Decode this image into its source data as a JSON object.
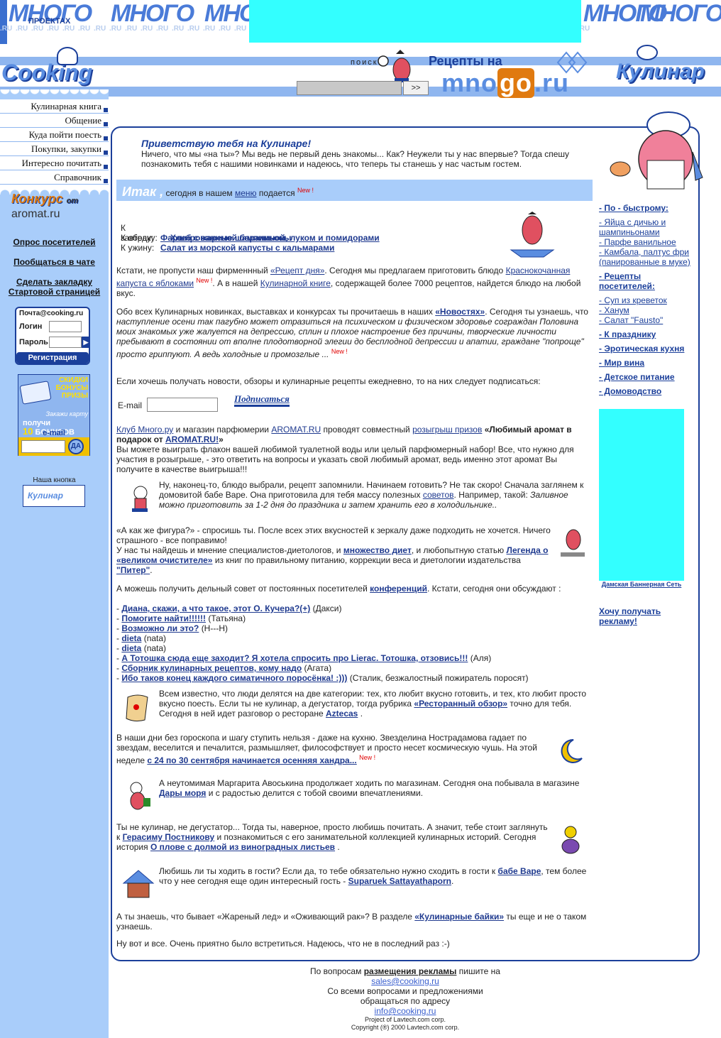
{
  "top_banner": {
    "word": "МНОГО",
    "proektah": "ПРОЕКТАХ",
    "ru_text": ".RU .RU .RU .RU .RU .RU .RU .RU .RU .RU .RU .RU .RU .RU .RU .RU .RU .RU .RU .RU .RU .RU .RU .RU .RU .RU .RU .RU .RU .RU .RU .RU .RU .RU .RU .RU .RU .RU"
  },
  "header": {
    "cooking_logo": "Cooking",
    "search_label": "поиск",
    "search_button": ">>",
    "recepty_na": "Рецепты на",
    "mnogo_pre": "mno",
    "mnogo_go": "go",
    "mnogo_post": ".ru",
    "kulinar_logo": "Кулинар"
  },
  "left_menu": [
    "Кулинарная книга",
    "Общение",
    "Куда пойти поесть",
    "Покупки, закупки",
    "Интересно почитать",
    "Справочник"
  ],
  "konkurs": {
    "title": "Конкурс",
    "ot": "от",
    "site": "aromat.ru"
  },
  "left_links": {
    "survey": "Опрос посетителей",
    "chat": "Пообщаться в чате",
    "bookmark": "Сделать закладку",
    "homepage": "Стартовой страницей"
  },
  "mail_box": {
    "title": "Почта@cooking.ru",
    "login_label": "Логин",
    "password_label": "Пароль",
    "register": "Регистрация"
  },
  "bonus_banner": {
    "lines": [
      "СКИДКИ",
      "БОНУСЫ",
      "ПРИЗЫ"
    ],
    "order": "Закажи карту",
    "get": "получи",
    "count": "10",
    "bonuses": "БОНУСОВ",
    "email": "e-mail",
    "yes": "ДА"
  },
  "our_button": {
    "label": "Наша кнопка",
    "text": "Кулинар"
  },
  "greeting": {
    "title": "Приветствую тебя на Кулинаре!",
    "text": "Ничего, что мы «на ты»? Мы ведь не первый день знакомы... Как? Неужели ты у нас впервые? Тогда спешу познакомить тебя с нашими новинками и надеюсь, что теперь ты станешь у нас частым гостем."
  },
  "itak": {
    "head": "Итак ,",
    "text_before": "сегодня в нашем",
    "link": "меню",
    "text_after": "подается",
    "new": "New !"
  },
  "meals": [
    {
      "label": "К завтраку:",
      "dish": "Хлеб с жареной бараниной, луком и помидорами"
    },
    {
      "label": "К обеду:",
      "dish": "Фаршированные шампиньоны"
    },
    {
      "label": "К ужину:",
      "dish": "Салат из морской капусты с кальмарами"
    }
  ],
  "recipe_day": {
    "t1": "Кстати, не пропусти наш фирменнный",
    "l1": "«Рецепт дня»",
    "t2": ". Сегодня мы предлагаем приготовить блюдо",
    "l2": "Краснокочанная капуста с яблоками",
    "new": "New !",
    "t3": ". А в нашей",
    "l3": "Кулинарной книге",
    "t4": ", содержащей более 7000 рецептов, найдется блюдо на любой вкус."
  },
  "news": {
    "t1": "Обо всех Кулинарных новинках, выставках и конкурсах ты прочитаешь в наших",
    "l1": "«Новостях»",
    "t2": ". Сегодня ты узнаешь, что",
    "italic": "наступление осени так пагубно может отразиться на психическом и физическом здоровье сограждан Половина моих знакомых уже жалуется на депрессию, сплин и плохое настроение без причины, творческие личности пребывают в состоянии от вполне плодотворной элегии до бесплодной депрессии и апатии, граждане \"попроще\" просто гриппуют. А ведь холодные и промозглые ...",
    "new": "New !"
  },
  "subscribe": {
    "text": "Если хочешь получать новости, обзоры и кулинарные рецепты ежедневно, то на них следует подписаться:",
    "email_label": "E-mail",
    "button": "Подписаться"
  },
  "aromat": {
    "l1": "Клуб Много.ру",
    "t1": "и магазин парфюмерии",
    "l2": "AROMAT.RU",
    "t2": "проводят совместный",
    "l3": "розыгрыш призов",
    "b1": "«Любимый аромат в подарок от",
    "l4": "AROMAT.RU!",
    "b2": "»",
    "t3": "Вы можете выиграть флакон вашей любимой туалетной воды или целый парфюмерный набор! Все, что нужно для участия в розыгрыше, - это ответить на вопросы и указать свой любимый аромат, ведь именно этот аромат Вы получите в качестве выигрыша!!!"
  },
  "advice": {
    "t1": "Ну, наконец-то, блюдо выбрали, рецепт запомнили. Начинаем готовить? Не так скоро! Сначала заглянем к домовитой бабе Варе. Она приготовила для тебя массу полезных",
    "l1": "советов",
    "t2": ". Например, такой:",
    "i1": "Заливное можно приготовить за 1-2 дня до праздника и затем хранить его в холодильнике.."
  },
  "figure": {
    "t1": "«А как же фигура?» - спросишь ты. После всех этих вкусностей к зеркалу даже подходить не хочется. Ничего страшного - все поправимо!",
    "t2": "У нас ты найдешь и мнение специалистов-диетологов, и",
    "l1": "множество диет",
    "t3": ", и любопытную статью",
    "l2": "Легенда о «великом очистителе»",
    "t4": "из книг по правильному питанию, коррекции веса и диетологии издательства",
    "l3": "\"Питер\"",
    "t5": "."
  },
  "conference": {
    "t1": "А можешь получить дельный совет от постоянных посетителей",
    "l1": "конференций",
    "t2": ". Кстати, сегодня они обсуждают :"
  },
  "topics": [
    {
      "title": "Диана, скажи, а что такое, этот О. Кучера?(+)",
      "author": "(Дакси)"
    },
    {
      "title": "Помогите найти!!!!!!",
      "author": "(Татьяна)"
    },
    {
      "title": "Возможно ли это?",
      "author": "(Н---Н)"
    },
    {
      "title": "dieta",
      "author": "(nata)"
    },
    {
      "title": "dieta",
      "author": "(nata)"
    },
    {
      "title": "А Тотошка сюда еще заходит? Я хотела спросить про Lierac. Тотошка, отзовись!!!",
      "author": "(Аля)"
    },
    {
      "title": "Сборник кулинарных рецептов, кому надо",
      "author": "(Агата)"
    },
    {
      "title": "Ибо таков конец каждого симатичного поросёнка! :)))",
      "author": "(Сталик, безжалостный пожиратель поросят)"
    }
  ],
  "restaurant": {
    "t1": "Всем известно, что люди делятся на две категории: тех, кто любит вкусно готовить, и тех, кто любит просто вкусно поесть. Если ты не кулинар, а дегустатор, тогда рубрика",
    "l1": "«Ресторанный обзор»",
    "t2": "точно для тебя. Сегодня в ней идет разговор о ресторане",
    "l2": "Aztecas",
    "t3": "."
  },
  "horoscope": {
    "t1": "В наши дни без гороскопа и шагу ступить нельзя - даже на кухню. Звезделина Нострадамова гадает по звездам, веселится и печалится, размышляет, философствует и просто несет космическую чушь. На этой неделе",
    "l1": "с 24 по 30 сентября начинается осенняя хандра...",
    "new": "New !"
  },
  "shopping": {
    "t1": "А неутомимая Маргарита Авоськина продолжает ходить по магазинам. Сегодня она побывала в магазине",
    "l1": "Дары моря",
    "t2": "и с радостью делится с тобой своими впечатлениями."
  },
  "stories": {
    "t1": "Ты не кулинар, не дегустатор... Тогда ты, наверное, просто любишь почитать. А значит, тебе стоит заглянуть к",
    "l1": "Герасиму Постникову",
    "t2": "и познакомиться с его занимательной коллекцией кулинарных историй. Сегодня история",
    "l2": "О плове с долмой из виноградных листьев",
    "t3": "."
  },
  "guests": {
    "t1": "Любишь ли ты ходить в гости? Если да, то тебе обязательно нужно сходить в гости к",
    "l1": "бабе Варе",
    "t2": ", тем более что у нее сегодня еще один интересный гость -",
    "l2": "Suparuek Sattayathaporn",
    "t3": "."
  },
  "tales": {
    "t1": "А ты знаешь, что бывает «Жареный лед» и «Оживающий рак»? В разделе",
    "l1": "«Кулинарные байки»",
    "t2": "ты еще и не о таком узнаешь."
  },
  "bye": "Ну вот и все. Очень приятно было встретиться. Надеюсь, что не в последний раз :-)",
  "right_menu": {
    "fast": "- По - быстрому:",
    "fast_items": [
      "- Яйца с дичью и шампиньонами",
      "- Парфе ванильное",
      "- Камбала, палтус фри (панированные в муке)"
    ],
    "visitors": "- Рецепты посетителей:",
    "visitor_items": [
      "- Суп из креветок",
      "- Ханум",
      "- Салат \"Fausto\""
    ],
    "holiday": "- К празднику",
    "erotic": "- Эротическая кухня",
    "wine": "- Мир вина",
    "kids": "- Детское питание",
    "home": "- Домоводство"
  },
  "banner_label": "Дамская Баннерная Сеть",
  "want_ad": "Хочу получать рекламу!",
  "footer": {
    "t1": "По вопросам",
    "b1": "размещения рекламы",
    "t2": "пишите на",
    "mail1": "sales@cooking.ru",
    "t3": "Со всеми вопросами и предложениями",
    "t4": "обращаться по адресу",
    "mail2": "info@cooking.ru",
    "project": "Project of Lavtech.com corp.",
    "copyright": "Copyright (®) 2000 Lavtech.com corp."
  },
  "colors": {
    "link": "#1f3a8f",
    "sidebar": "#a9cdfa",
    "frame": "#1b3f9a",
    "ad_placeholder": "#33ffff",
    "new": "#e00000"
  }
}
